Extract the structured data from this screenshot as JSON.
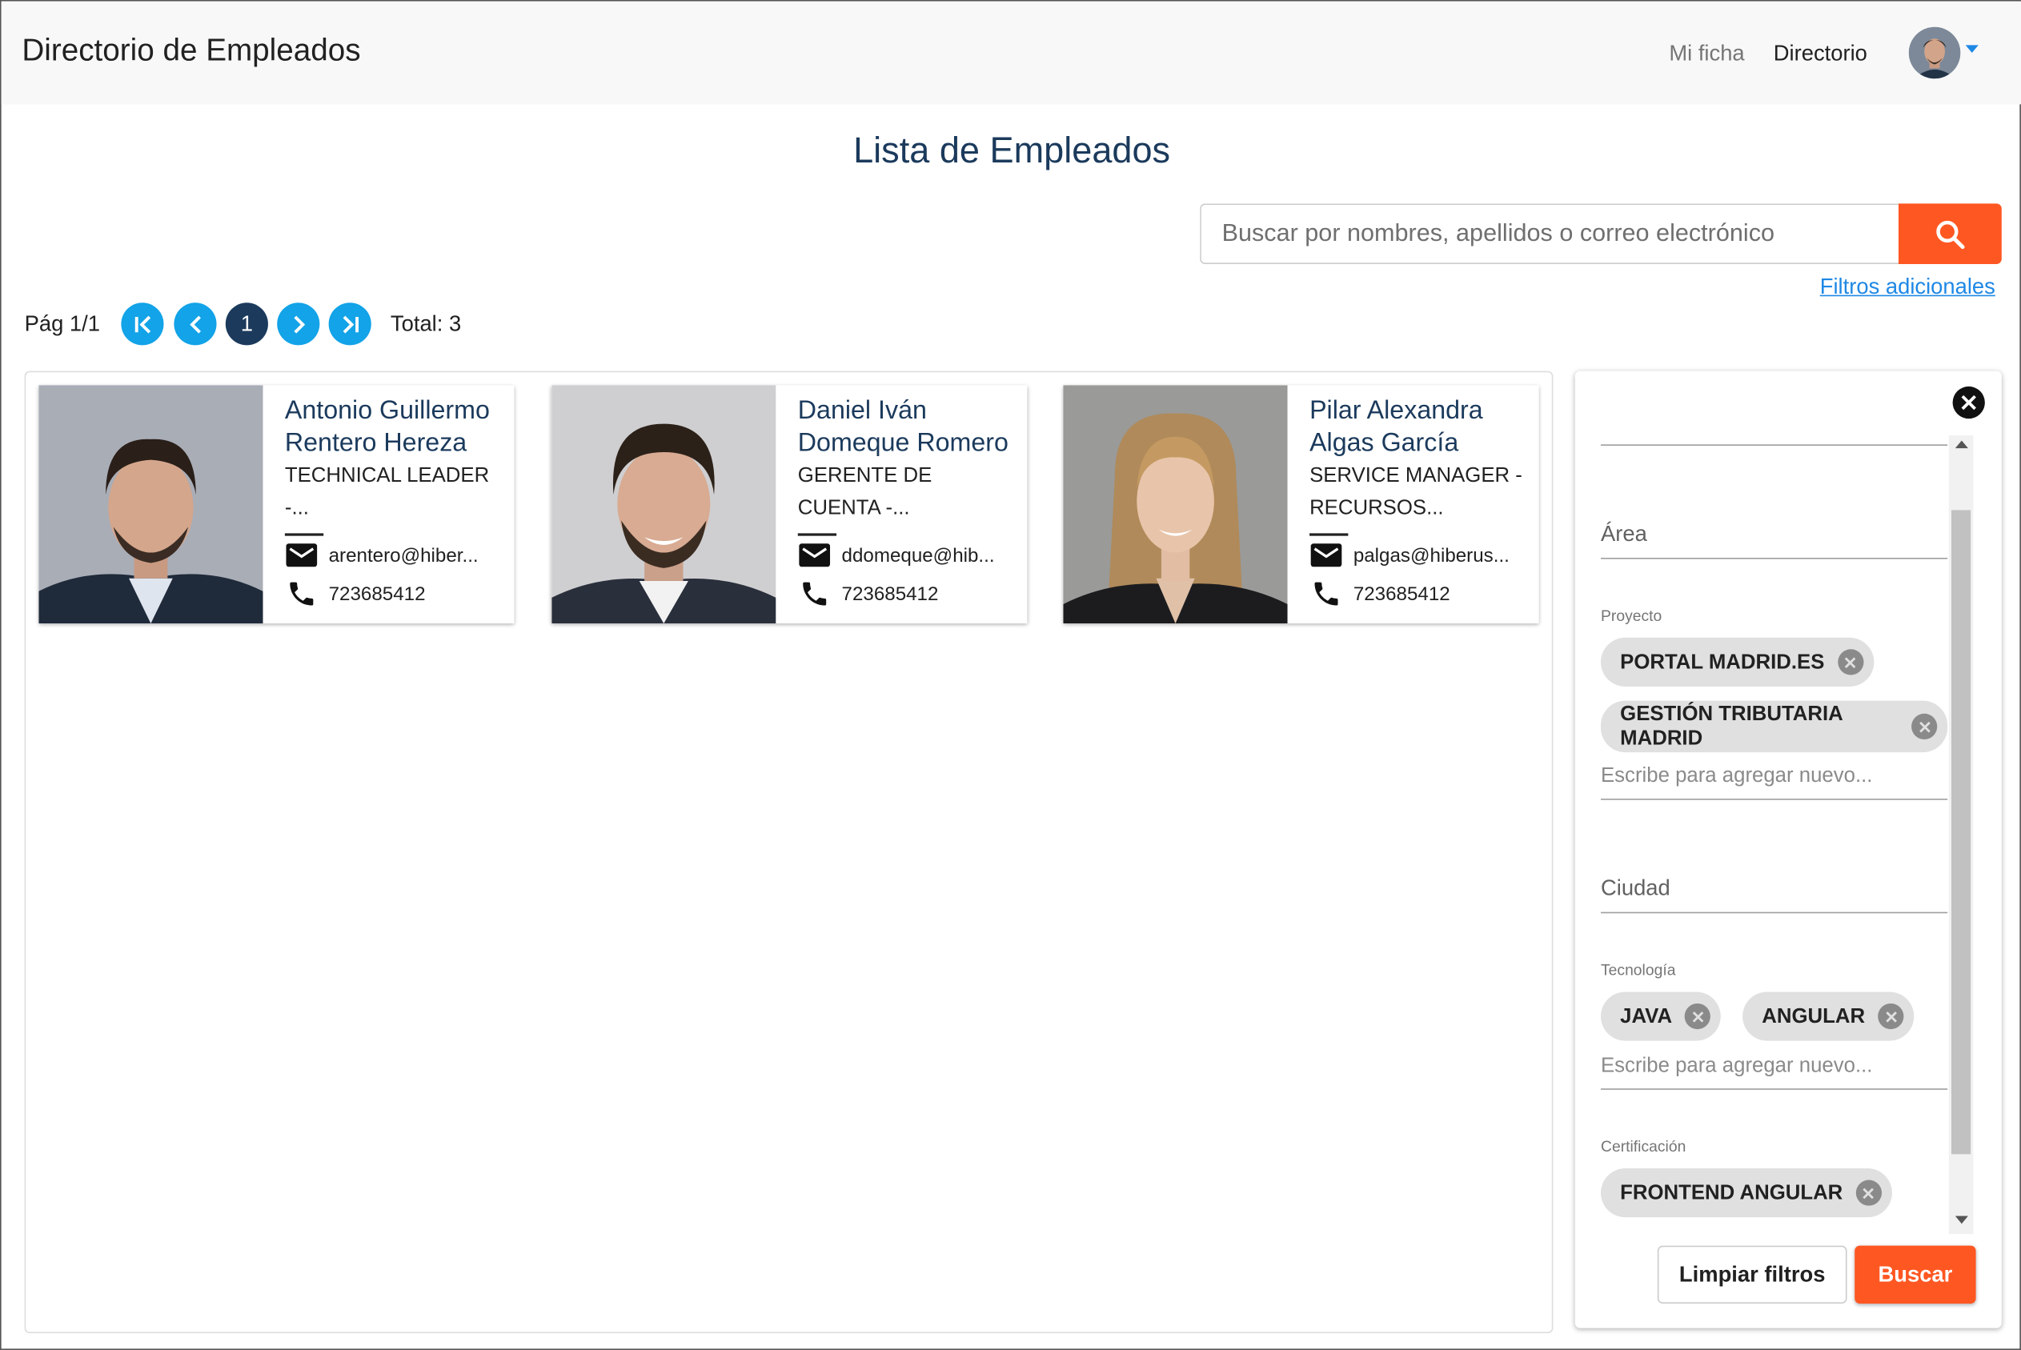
{
  "header": {
    "app_title": "Directorio de Empleados",
    "nav_my_file": "Mi ficha",
    "nav_directory": "Directorio"
  },
  "main": {
    "page_title": "Lista de Empleados",
    "search_placeholder": "Buscar por nombres, apellidos o correo electrónico",
    "filters_link": "Filtros adicionales"
  },
  "pagination": {
    "page_label": "Pág 1/1",
    "current_page": "1",
    "total_label": "Total: 3"
  },
  "employees": [
    {
      "name": "Antonio Guillermo Rentero Hereza",
      "role": "TECHNICAL LEADER -...",
      "email": "arentero@hiber...",
      "phone": "723685412"
    },
    {
      "name": "Daniel Iván Domeque Romero",
      "role": "GERENTE DE CUENTA -...",
      "email": "ddomeque@hib...",
      "phone": "723685412"
    },
    {
      "name": "Pilar Alexandra Algas García",
      "role": "SERVICE MANAGER - RECURSOS...",
      "email": "palgas@hiberus...",
      "phone": "723685412"
    }
  ],
  "filters": {
    "area_label": "Área",
    "project_caption": "Proyecto",
    "project_chips": [
      "PORTAL MADRID.ES",
      "GESTIÓN TRIBUTARIA MADRID"
    ],
    "add_placeholder": "Escribe para agregar nuevo...",
    "city_label": "Ciudad",
    "tech_caption": "Tecnología",
    "tech_chips": [
      "JAVA",
      "ANGULAR"
    ],
    "cert_caption": "Certificación",
    "cert_chips": [
      "FRONTEND ANGULAR"
    ],
    "clear_button": "Limpiar filtros",
    "search_button": "Buscar"
  },
  "colors": {
    "accent": "#ff5722",
    "primary_dark": "#1b3a5c",
    "pagination_blue": "#12a3e8",
    "link_blue": "#1e88e5"
  }
}
